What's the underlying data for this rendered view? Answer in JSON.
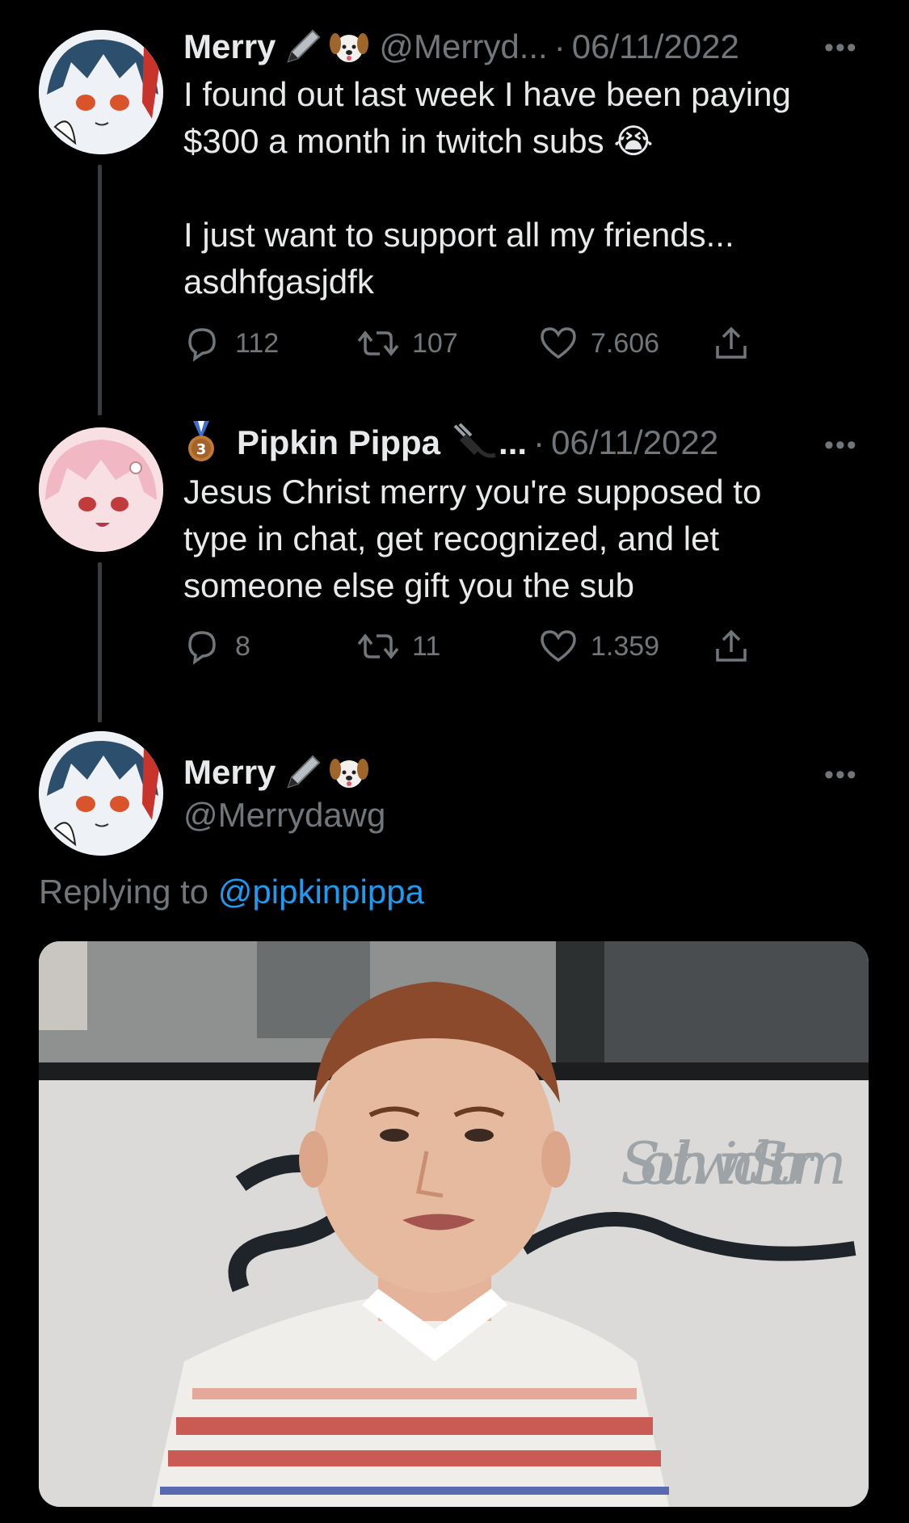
{
  "tweets": [
    {
      "name": "Merry",
      "handle": "@Merryd...",
      "date": "06/11/2022",
      "text_lines": [
        "I found out last week I have been paying",
        "$300 a month in twitch subs",
        "",
        "I just want to support all my friends...",
        "asdhfgasjdfk"
      ],
      "stats": {
        "replies": "112",
        "retweets": "107",
        "likes": "7.606"
      },
      "emoji": "😭",
      "badge_icons": [
        "pen-icon",
        "dog-icon"
      ]
    },
    {
      "name": "Pipkin Pippa",
      "ellipsis": "...",
      "date": "06/11/2022",
      "text_lines": [
        "Jesus Christ merry you're supposed to",
        "type in chat, get recognized, and let",
        "someone else gift you the sub"
      ],
      "stats": {
        "replies": "8",
        "retweets": "11",
        "likes": "1.359"
      },
      "badge_icons": [
        "medal-icon",
        "plug-icon"
      ]
    }
  ],
  "main_tweet": {
    "name": "Merry",
    "handle": "@Merrydawg",
    "replying_prefix": "Replying to",
    "replying_handle": "@pipkinpippa",
    "image_watermark": "Southwind Storm",
    "badge_icons": [
      "pen-icon",
      "dog-icon"
    ]
  },
  "separator": "·",
  "more_label": "•••",
  "colors": {
    "background": "#000000",
    "text": "#e7e9ea",
    "muted": "#71767b",
    "link": "#1d9bf0",
    "thread_line": "#3a3d40"
  }
}
